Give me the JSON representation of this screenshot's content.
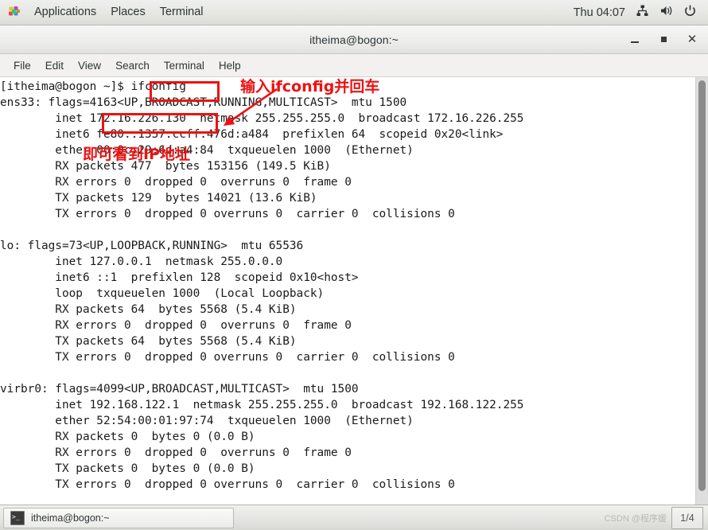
{
  "top_panel": {
    "apps_icon": "applications-pinwheel-icon",
    "menus": [
      {
        "label": "Applications"
      },
      {
        "label": "Places"
      },
      {
        "label": "Terminal"
      }
    ],
    "clock": "Thu 04:07",
    "tray": [
      {
        "icon": "network-icon"
      },
      {
        "icon": "volume-icon"
      },
      {
        "icon": "power-icon"
      }
    ]
  },
  "window": {
    "title": "itheima@bogon:~",
    "controls": {
      "minimize": "minimize-icon",
      "maximize": "maximize-icon",
      "close": "close-icon"
    },
    "menubar": [
      {
        "label": "File"
      },
      {
        "label": "Edit"
      },
      {
        "label": "View"
      },
      {
        "label": "Search"
      },
      {
        "label": "Terminal"
      },
      {
        "label": "Help"
      }
    ]
  },
  "terminal": {
    "content": "[itheima@bogon ~]$ ifconfig\nens33: flags=4163<UP,BROADCAST,RUNNING,MULTICAST>  mtu 1500\n        inet 172.16.226.130  netmask 255.255.255.0  broadcast 172.16.226.255\n        inet6 fe80::1357:ccff:476d:a484  prefixlen 64  scopeid 0x20<link>\n        ether 00:0c:29:6d:a4:84  txqueuelen 1000  (Ethernet)\n        RX packets 477  bytes 153156 (149.5 KiB)\n        RX errors 0  dropped 0  overruns 0  frame 0\n        TX packets 129  bytes 14021 (13.6 KiB)\n        TX errors 0  dropped 0 overruns 0  carrier 0  collisions 0\n\nlo: flags=73<UP,LOOPBACK,RUNNING>  mtu 65536\n        inet 127.0.0.1  netmask 255.0.0.0\n        inet6 ::1  prefixlen 128  scopeid 0x10<host>\n        loop  txqueuelen 1000  (Local Loopback)\n        RX packets 64  bytes 5568 (5.4 KiB)\n        RX errors 0  dropped 0  overruns 0  frame 0\n        TX packets 64  bytes 5568 (5.4 KiB)\n        TX errors 0  dropped 0 overruns 0  carrier 0  collisions 0\n\nvirbr0: flags=4099<UP,BROADCAST,MULTICAST>  mtu 1500\n        inet 192.168.122.1  netmask 255.255.255.0  broadcast 192.168.122.255\n        ether 52:54:00:01:97:74  txqueuelen 1000  (Ethernet)\n        RX packets 0  bytes 0 (0.0 B)\n        RX errors 0  dropped 0  overruns 0  frame 0\n        TX packets 0  bytes 0 (0.0 B)\n        TX errors 0  dropped 0 overruns 0  carrier 0  collisions 0"
  },
  "annotations": {
    "color": "#ee1111",
    "command_note": "输入ifconfig并回车",
    "ip_note": "即可看到IP地址",
    "boxed_command": "ifconfig",
    "boxed_ip": "172.16.226.130"
  },
  "taskbar": {
    "task_icon": "terminal-icon",
    "task_label": "itheima@bogon:~",
    "watermark": "CSDN @程序媛",
    "workspace": "1/4"
  }
}
